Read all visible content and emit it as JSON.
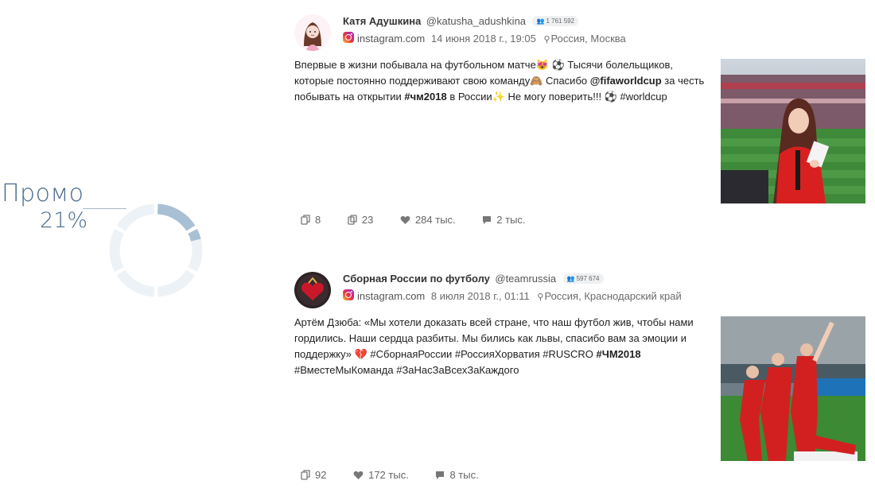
{
  "promo": {
    "label": "Промо",
    "value": "21%",
    "fraction": 0.21,
    "colors": {
      "filled": "#a9c0d4",
      "track": "#edf2f6",
      "text": "#4a6a8a"
    }
  },
  "posts": [
    {
      "author": "Катя Адушкина",
      "handle": "@katusha_adushkina",
      "followers": "1 761 592",
      "source": "instagram.com",
      "date": "14 июня 2018 г., 19:05",
      "location": "Россия, Москва",
      "text": {
        "p1": "Впервые в жизни побывала на футбольном матче😻 ⚽️ Тысячи болельщиков, которые постоянно поддерживают свою команду🙈  Спасибо ",
        "mention": "@fifaworldcup",
        "p2": " за честь побывать на открытии ",
        "tag1": "#чм2018",
        "p3": " в России✨  Не могу поверить!!! ⚽️  #worldcup"
      },
      "stats": {
        "copies": "8",
        "reposts": "23",
        "likes": "284 тыс.",
        "comments": "2 тыс."
      }
    },
    {
      "author": "Сборная России по футболу",
      "handle": "@teamrussia",
      "followers": "597 674",
      "source": "instagram.com",
      "date": "8 июля 2018 г., 01:11",
      "location": "Россия, Краснодарский край",
      "text": {
        "p1": "Артём Дзюба: «Мы хотели доказать всей стране, что наш футбол жив, чтобы нами гордились. Наши сердца разбиты. Мы бились как львы, спасибо вам за эмоции и поддержку» 💔        #СборнаяРоссии #РоссияХорватия #RUSCRO ",
        "tag1": "#ЧМ2018",
        "p2": " #ВместеМыКоманда #ЗаНасЗаВсехЗаКаждого"
      },
      "stats": {
        "copies": "92",
        "likes": "172 тыс.",
        "comments": "8 тыс."
      }
    }
  ]
}
